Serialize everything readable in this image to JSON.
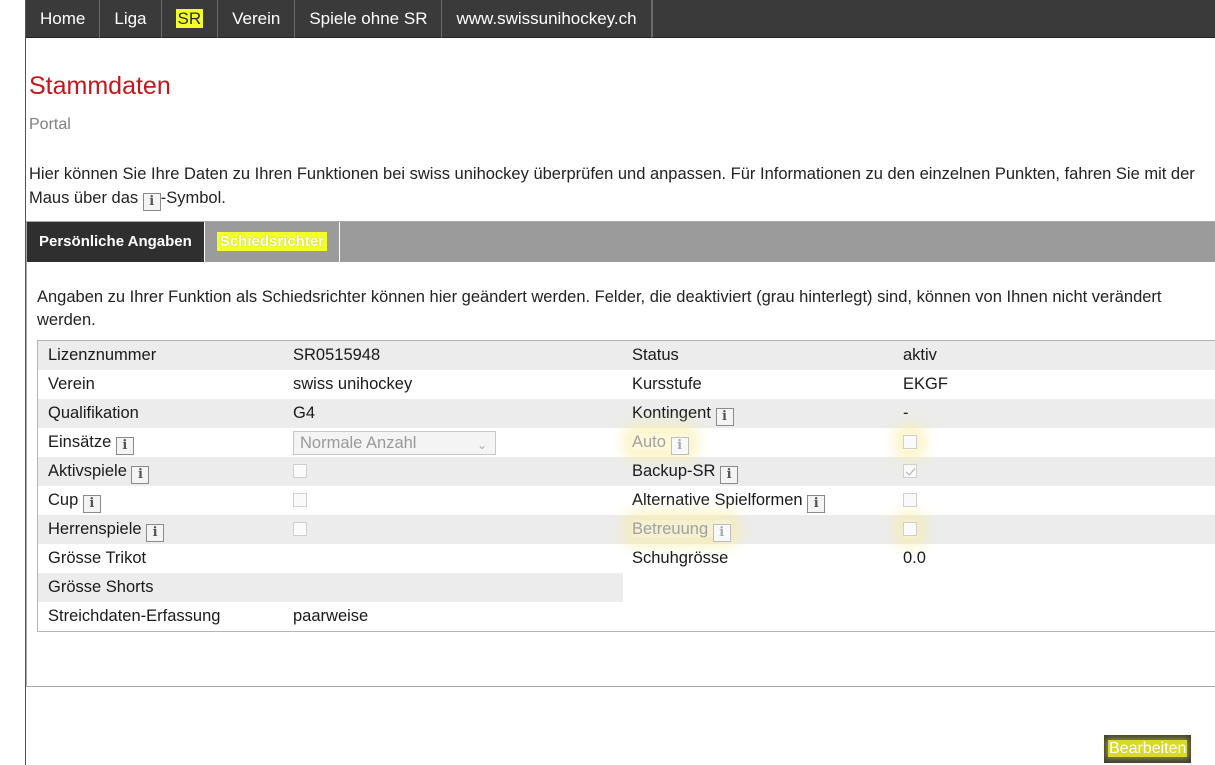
{
  "nav": {
    "items": [
      "Home",
      "Liga",
      "SR",
      "Verein",
      "Spiele ohne SR",
      "www.swissunihockey.ch"
    ]
  },
  "page": {
    "title": "Stammdaten",
    "subtitle": "Portal",
    "intro_part1": "Hier können Sie Ihre Daten zu Ihren Funktionen bei swiss unihockey überprüfen und anpassen. Für Informationen zu den einzelnen Punkten, fahren Sie mit der Maus über das ",
    "intro_part2": "-Symbol."
  },
  "tabs": [
    "Persönliche Angaben",
    "Schiedsrichter"
  ],
  "panel": {
    "description": "Angaben zu Ihrer Funktion als Schiedsrichter können hier geändert werden. Felder, die deaktiviert (grau hinterlegt) sind, können von Ihnen nicht verändert werden."
  },
  "rows": {
    "r1": {
      "l1": "Lizenznummer",
      "v1": "SR0515948",
      "l2": "Status",
      "v2": "aktiv"
    },
    "r2": {
      "l1": "Verein",
      "v1": "swiss unihockey",
      "l2": "Kursstufe",
      "v2": "EKGF"
    },
    "r3": {
      "l1": "Qualifikation",
      "v1": "G4",
      "l2": "Kontingent",
      "v2": "-"
    },
    "r4": {
      "l1": "Einsätze",
      "v1_select": "Normale Anzahl",
      "l2": "Auto",
      "v2_checked": false
    },
    "r5": {
      "l1": "Aktivspiele",
      "v1_checked": false,
      "l2": "Backup-SR",
      "v2_checked": true
    },
    "r6": {
      "l1": "Cup",
      "v1_checked": false,
      "l2": "Alternative Spielformen",
      "v2_checked": false
    },
    "r7": {
      "l1": "Herrenspiele",
      "v1_checked": false,
      "l2": "Betreuung",
      "v2_checked": false
    },
    "r8": {
      "l1": "Grösse Trikot",
      "v1": "",
      "l2": "Schuhgrösse",
      "v2": "0.0"
    },
    "r9": {
      "l1": "Grösse Shorts",
      "v1": ""
    },
    "r10": {
      "l1": "Streichdaten-Erfassung",
      "v1": "paarweise"
    }
  },
  "info_icon": "i",
  "buttons": {
    "edit": "Bearbeiten"
  },
  "colors": {
    "title_red": "#c4161c",
    "nav_bg": "#3a3a3a",
    "highlight": "#f2ff2b"
  }
}
